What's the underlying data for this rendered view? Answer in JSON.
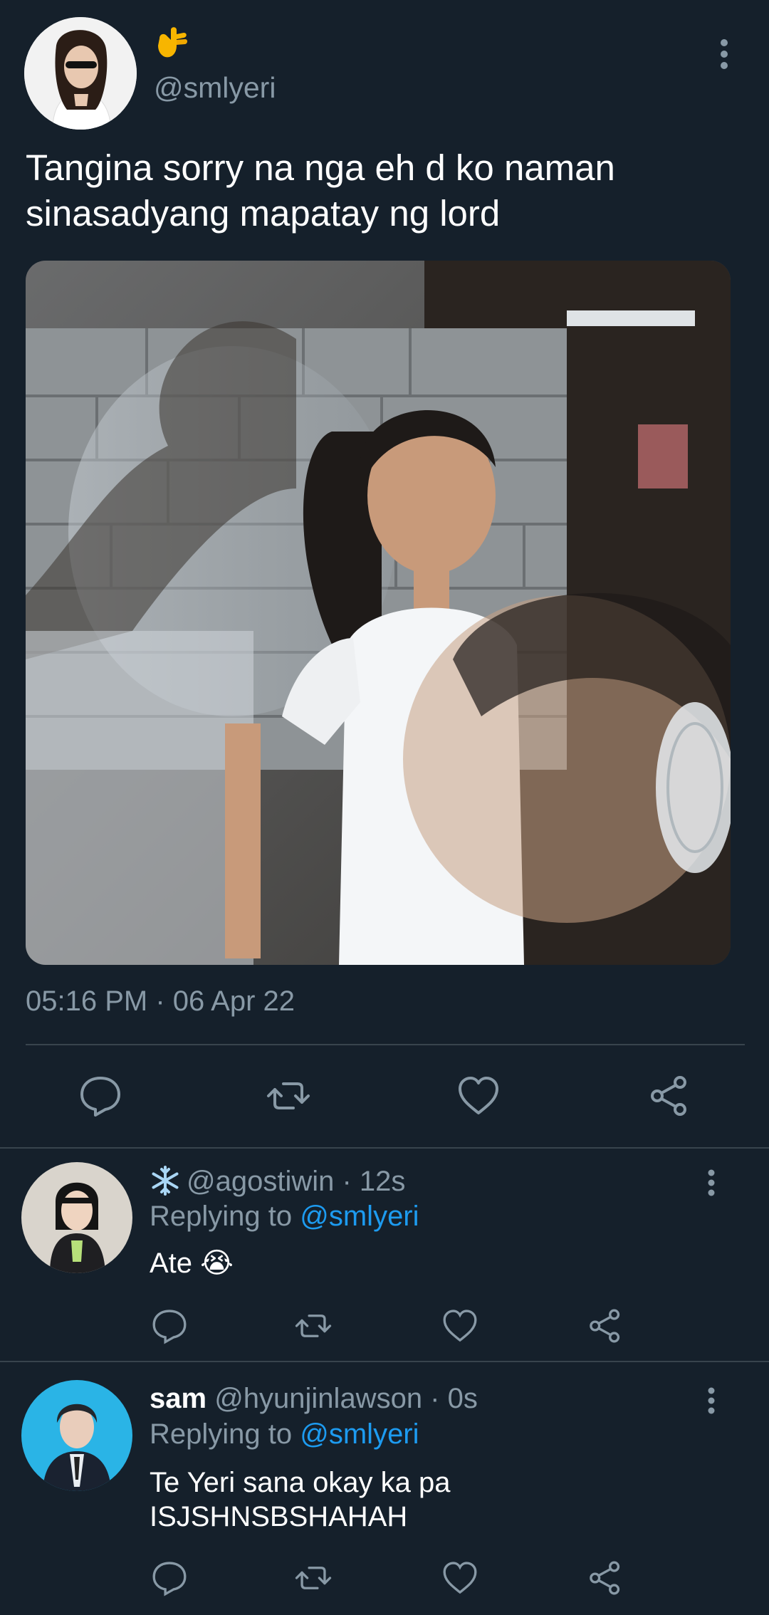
{
  "main_tweet": {
    "handle": "@smlyeri",
    "text_line1": "Tangina sorry na nga eh d ko naman",
    "text_line2": "sinasadyang mapatay ng lord",
    "timestamp": "05:16 PM · 06 Apr 22",
    "emoji_icon": "hand-emoji-icon",
    "photo_description_icon": "photo"
  },
  "replies": [
    {
      "badge_icon": "snowflake-icon",
      "display_name": "",
      "handle": "@agostiwin",
      "time": " · 12s",
      "replying_label": "Replying to",
      "replying_to": "@smlyeri",
      "text_line1": "Ate 😭",
      "text_line2": ""
    },
    {
      "badge_icon": "",
      "display_name": "sam",
      "handle": "@hyunjinlawson",
      "time": " · 0s",
      "replying_label": "Replying to",
      "replying_to": "@smlyeri",
      "text_line1": "Te Yeri sana okay ka pa",
      "text_line2": "ISJSHNSBSHAHAH"
    }
  ],
  "colors": {
    "background": "#15202b",
    "muted": "#8899a6",
    "link": "#1d9bf0",
    "divider": "#38444d"
  }
}
